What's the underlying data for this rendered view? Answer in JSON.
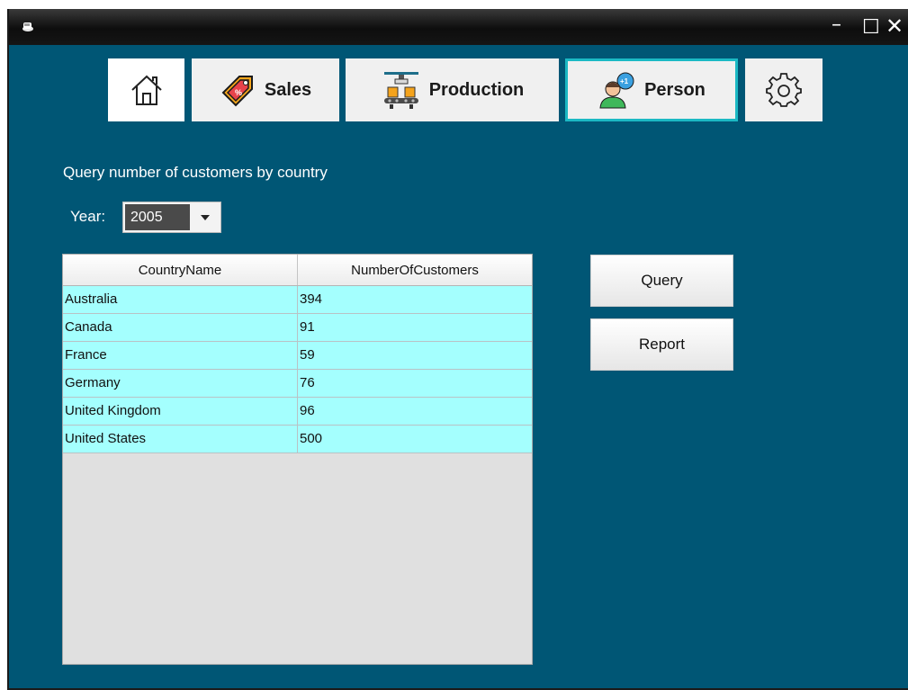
{
  "window": {
    "controls": {
      "minimize": "–",
      "maximize": "☐",
      "close": "✕"
    }
  },
  "nav": {
    "home_icon": "house-icon",
    "sales_label": "Sales",
    "production_label": "Production",
    "person_label": "Person",
    "settings_icon": "gear-icon"
  },
  "main": {
    "title": "Query number of customers by country",
    "year_label": "Year:",
    "year_value": "2005"
  },
  "table": {
    "columns": [
      "CountryName",
      "NumberOfCustomers"
    ],
    "rows": [
      [
        "Australia",
        "394"
      ],
      [
        "Canada",
        "91"
      ],
      [
        "France",
        "59"
      ],
      [
        "Germany",
        "76"
      ],
      [
        "United Kingdom",
        "96"
      ],
      [
        "United States",
        "500"
      ]
    ]
  },
  "actions": {
    "query_label": "Query",
    "report_label": "Report"
  },
  "colors": {
    "background": "#005675",
    "row_highlight": "#a4fffe",
    "active_tab_border": "#1bb9c4"
  }
}
